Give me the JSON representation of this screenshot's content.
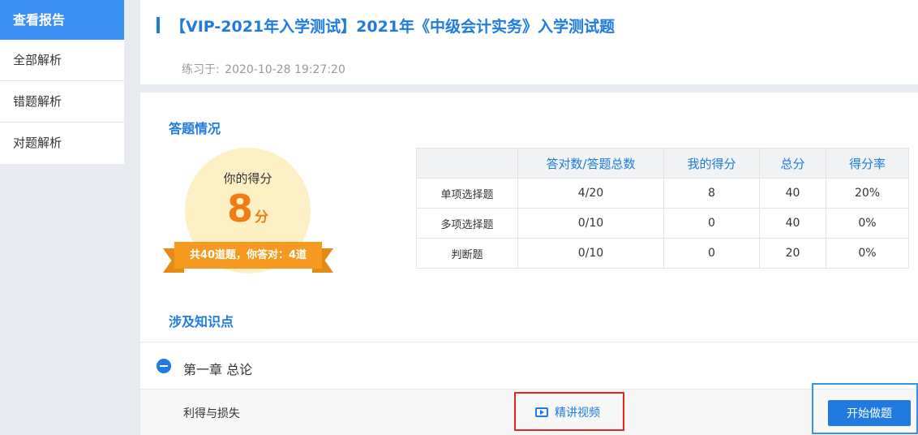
{
  "sidebar": {
    "title": "查看报告",
    "items": [
      {
        "label": "全部解析"
      },
      {
        "label": "错题解析"
      },
      {
        "label": "对题解析"
      }
    ]
  },
  "header": {
    "title": "【VIP-2021年入学测试】2021年《中级会计实务》入学测试题",
    "practice_label": "练习于:",
    "practice_time": "2020-10-28 19:27:20"
  },
  "answers": {
    "section_title": "答题情况",
    "score_label": "你的得分",
    "score_value": "8",
    "score_unit": "分",
    "ribbon": "共40道题，你答对：4道"
  },
  "table": {
    "headers": [
      "",
      "答对数/答题总数",
      "我的得分",
      "总分",
      "得分率"
    ],
    "rows": [
      [
        "单项选择题",
        "4/20",
        "8",
        "40",
        "20%"
      ],
      [
        "多项选择题",
        "0/10",
        "0",
        "40",
        "0%"
      ],
      [
        "判断题",
        "0/10",
        "0",
        "20",
        "0%"
      ]
    ]
  },
  "knowledge": {
    "section_title": "涉及知识点",
    "chapter": "第一章 总论",
    "topic": "利得与损失",
    "video_label": "精讲视频",
    "start_label": "开始做题"
  },
  "colors": {
    "accent": "#1f7be0",
    "sidebar_active": "#3b8ff0",
    "score_orange": "#f07c14",
    "highlight_red": "#e5261f"
  }
}
